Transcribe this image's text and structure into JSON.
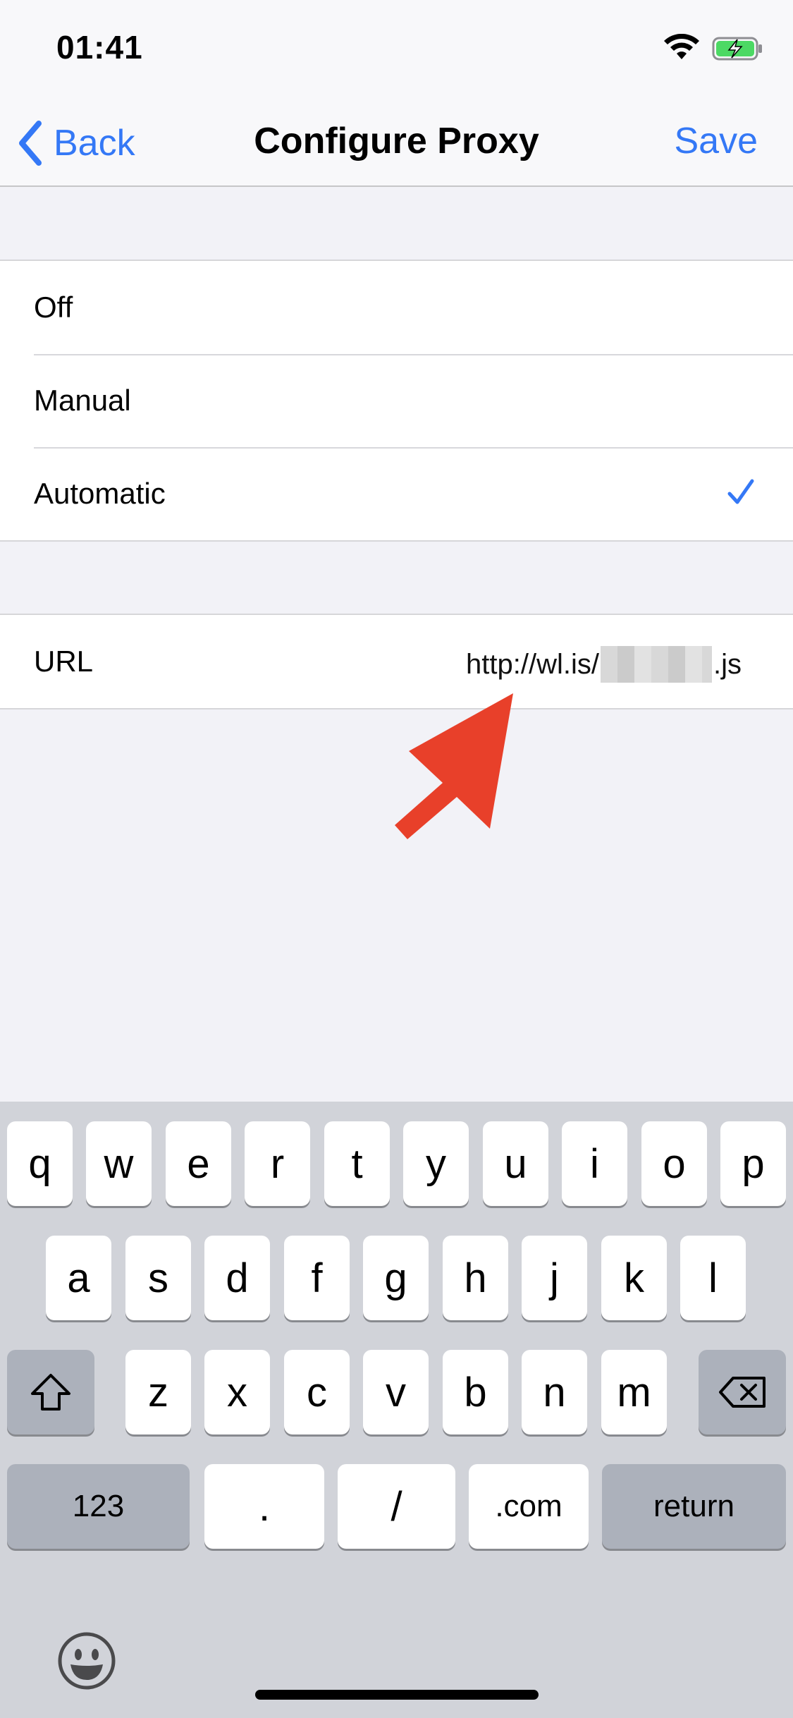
{
  "status_bar": {
    "time": "01:41"
  },
  "nav": {
    "back_label": "Back",
    "title": "Configure Proxy",
    "save_label": "Save"
  },
  "proxy_options": [
    {
      "label": "Off"
    },
    {
      "label": "Manual"
    },
    {
      "label": "Automatic",
      "selected": true
    }
  ],
  "url": {
    "label": "URL",
    "value_prefix": "http://wl.is/",
    "value_suffix": ".js",
    "redacted": true
  },
  "keyboard": {
    "row1": [
      "q",
      "w",
      "e",
      "r",
      "t",
      "y",
      "u",
      "i",
      "o",
      "p"
    ],
    "row2": [
      "a",
      "s",
      "d",
      "f",
      "g",
      "h",
      "j",
      "k",
      "l"
    ],
    "row3": [
      "z",
      "x",
      "c",
      "v",
      "b",
      "n",
      "m"
    ],
    "numbers_label": "123",
    "dot_label": ".",
    "slash_label": "/",
    "dotcom_label": ".com",
    "return_label": "return"
  },
  "colors": {
    "accent": "#3478f6",
    "annotation_arrow": "#e8402a"
  }
}
